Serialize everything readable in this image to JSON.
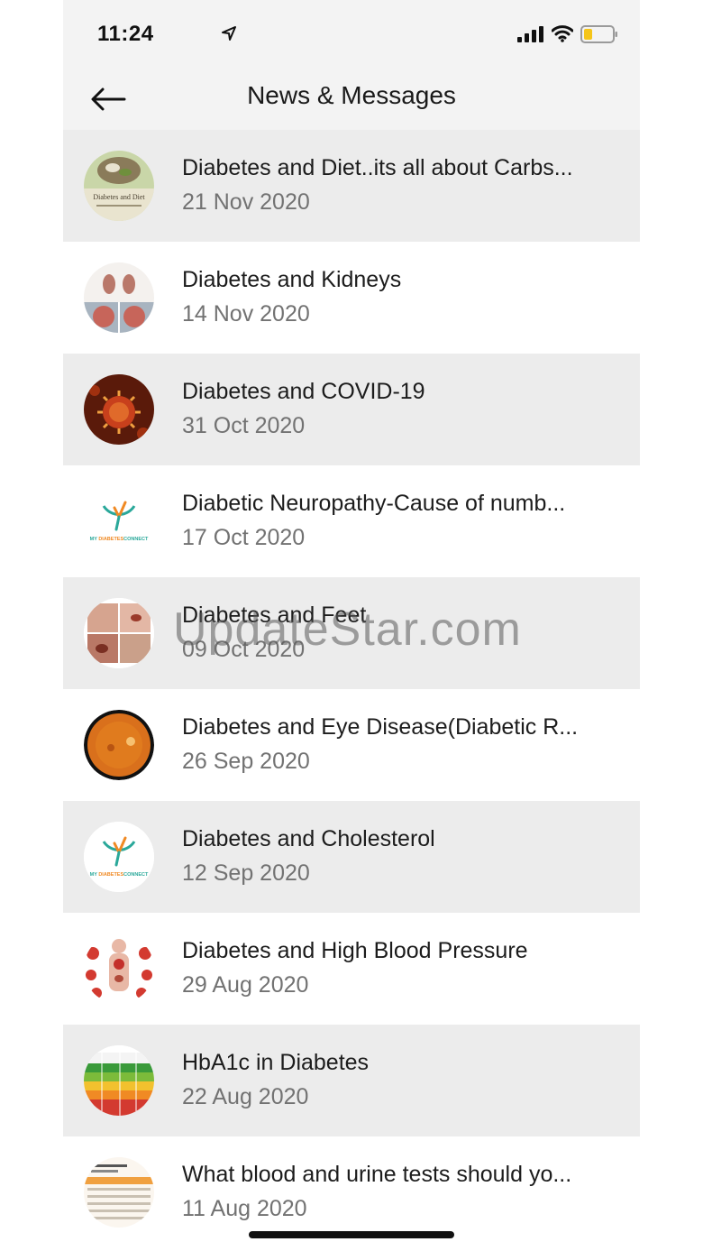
{
  "status_bar": {
    "time": "11:24",
    "icons": [
      "location-arrow-icon",
      "cellular-signal-icon",
      "wifi-icon",
      "battery-icon"
    ]
  },
  "nav": {
    "back_icon": "arrow-left-icon",
    "title": "News & Messages"
  },
  "items": [
    {
      "title": "Diabetes and Diet..its all about Carbs...",
      "date": "21 Nov 2020",
      "thumb": "diet-thumbnail"
    },
    {
      "title": "Diabetes and Kidneys",
      "date": "14 Nov 2020",
      "thumb": "kidney-thumbnail"
    },
    {
      "title": "Diabetes and COVID-19",
      "date": "31 Oct 2020",
      "thumb": "covid-thumbnail"
    },
    {
      "title": "Diabetic Neuropathy-Cause of numb...",
      "date": "17 Oct 2020",
      "thumb": "my-diabetes-connect-logo"
    },
    {
      "title": "Diabetes and Feet",
      "date": "09 Oct 2020",
      "thumb": "feet-thumbnail"
    },
    {
      "title": "Diabetes and Eye Disease(Diabetic R...",
      "date": "26 Sep 2020",
      "thumb": "retina-thumbnail"
    },
    {
      "title": "Diabetes and Cholesterol",
      "date": "12 Sep 2020",
      "thumb": "my-diabetes-connect-logo"
    },
    {
      "title": "Diabetes and High Blood Pressure",
      "date": "29 Aug 2020",
      "thumb": "body-organs-thumbnail"
    },
    {
      "title": "HbA1c in Diabetes",
      "date": "22 Aug 2020",
      "thumb": "hba1c-chart-thumbnail"
    },
    {
      "title": "What blood and urine tests should yo...",
      "date": "11 Aug 2020",
      "thumb": "tests-table-thumbnail"
    }
  ],
  "thumb_text": {
    "diet": "Diabetes and Diet",
    "logo_my": "MY",
    "logo_diabetes": "DIABETES",
    "logo_connect": "CONNECT"
  },
  "watermark": "UpdateStar.com",
  "colors": {
    "bar_background": "#f3f3f3",
    "row_shaded": "#ececec",
    "title_text": "#1c1c1c",
    "date_text": "#727272",
    "logo_teal": "#2aa89a",
    "logo_orange": "#f08a24"
  }
}
